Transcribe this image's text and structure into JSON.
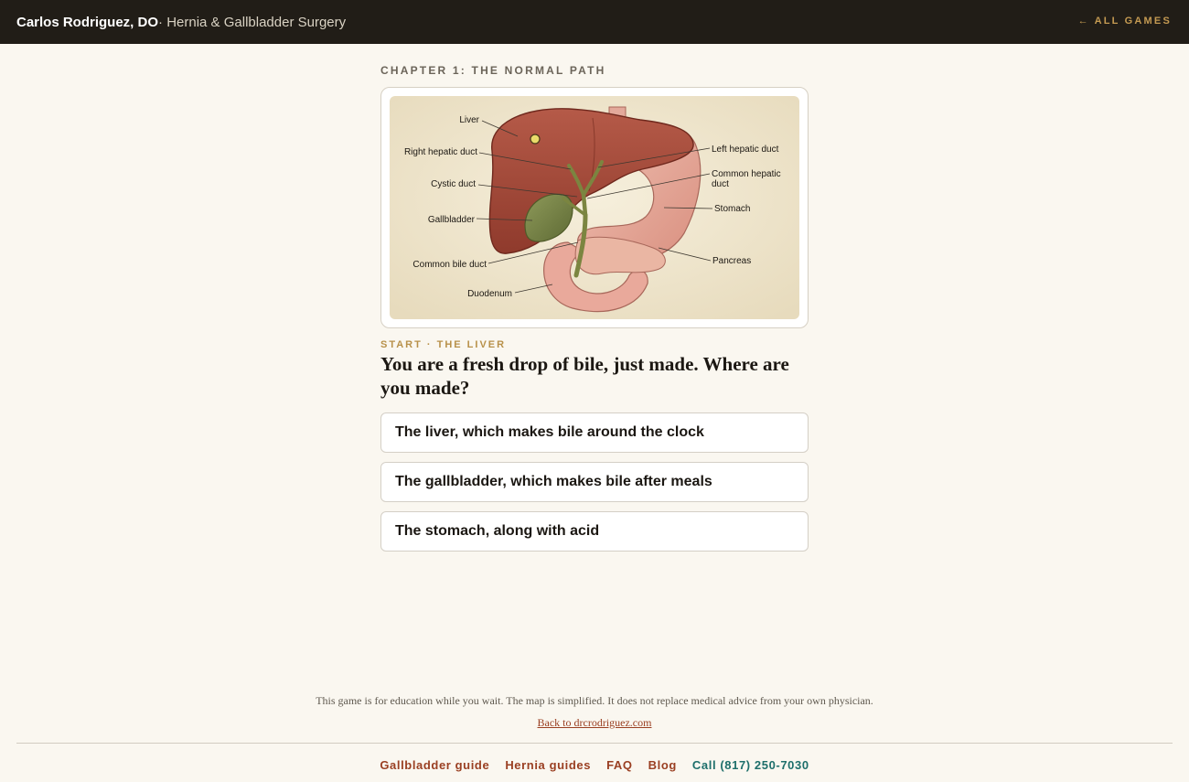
{
  "header": {
    "brand_name": "Carlos Rodriguez, DO",
    "brand_sub": "· Hernia & Gallbladder Surgery",
    "all_games": "← ALL GAMES"
  },
  "chapter": "CHAPTER 1: THE NORMAL PATH",
  "map": {
    "labels": {
      "liver": "Liver",
      "right_hepatic": "Right hepatic duct",
      "cystic": "Cystic duct",
      "gallbladder": "Gallbladder",
      "common_bile": "Common bile duct",
      "duodenum": "Duodenum",
      "left_hepatic": "Left hepatic duct",
      "common_hepatic_1": "Common hepatic",
      "common_hepatic_2": "duct",
      "stomach": "Stomach",
      "pancreas": "Pancreas"
    }
  },
  "step_label": "START · THE LIVER",
  "question": "You are a fresh drop of bile, just made. Where are you made?",
  "answers": [
    "The liver, which makes bile around the clock",
    "The gallbladder, which makes bile after meals",
    "The stomach, along with acid"
  ],
  "footer": {
    "disclaimer": "This game is for education while you wait. The map is simplified. It does not replace medical advice from your own physician.",
    "back_link": "Back to drcrodriguez.com",
    "nav": [
      "Gallbladder guide",
      "Hernia guides",
      "FAQ",
      "Blog"
    ],
    "call": "Call (817) 250-7030"
  },
  "colors": {
    "header_bg": "#211d17",
    "accent_gold": "#c49a52",
    "link_rust": "#9a3f22",
    "call_teal": "#1e6f6b",
    "page_bg": "#faf7f0"
  }
}
